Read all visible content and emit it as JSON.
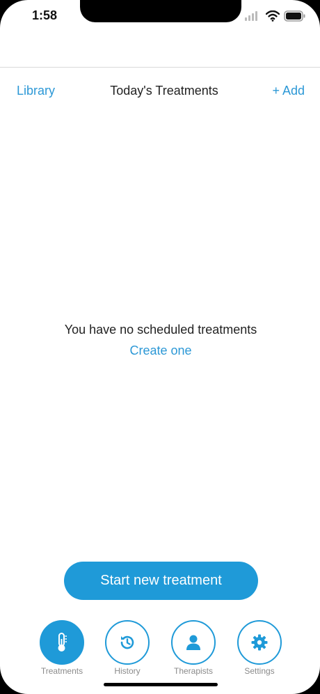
{
  "status_bar": {
    "time": "1:58"
  },
  "nav": {
    "left_label": "Library",
    "title": "Today's Treatments",
    "right_label": "+ Add"
  },
  "empty_state": {
    "message": "You have no scheduled treatments",
    "link_label": "Create one"
  },
  "primary_button": {
    "label": "Start new treatment"
  },
  "tabs": [
    {
      "label": "Treatments",
      "icon": "thermometer-icon",
      "active": true
    },
    {
      "label": "History",
      "icon": "history-icon",
      "active": false
    },
    {
      "label": "Therapists",
      "icon": "person-icon",
      "active": false
    },
    {
      "label": "Settings",
      "icon": "gear-icon",
      "active": false
    }
  ],
  "colors": {
    "accent": "#1f9ad8",
    "link": "#2c98d6",
    "tab_label": "#8a8a8a"
  }
}
